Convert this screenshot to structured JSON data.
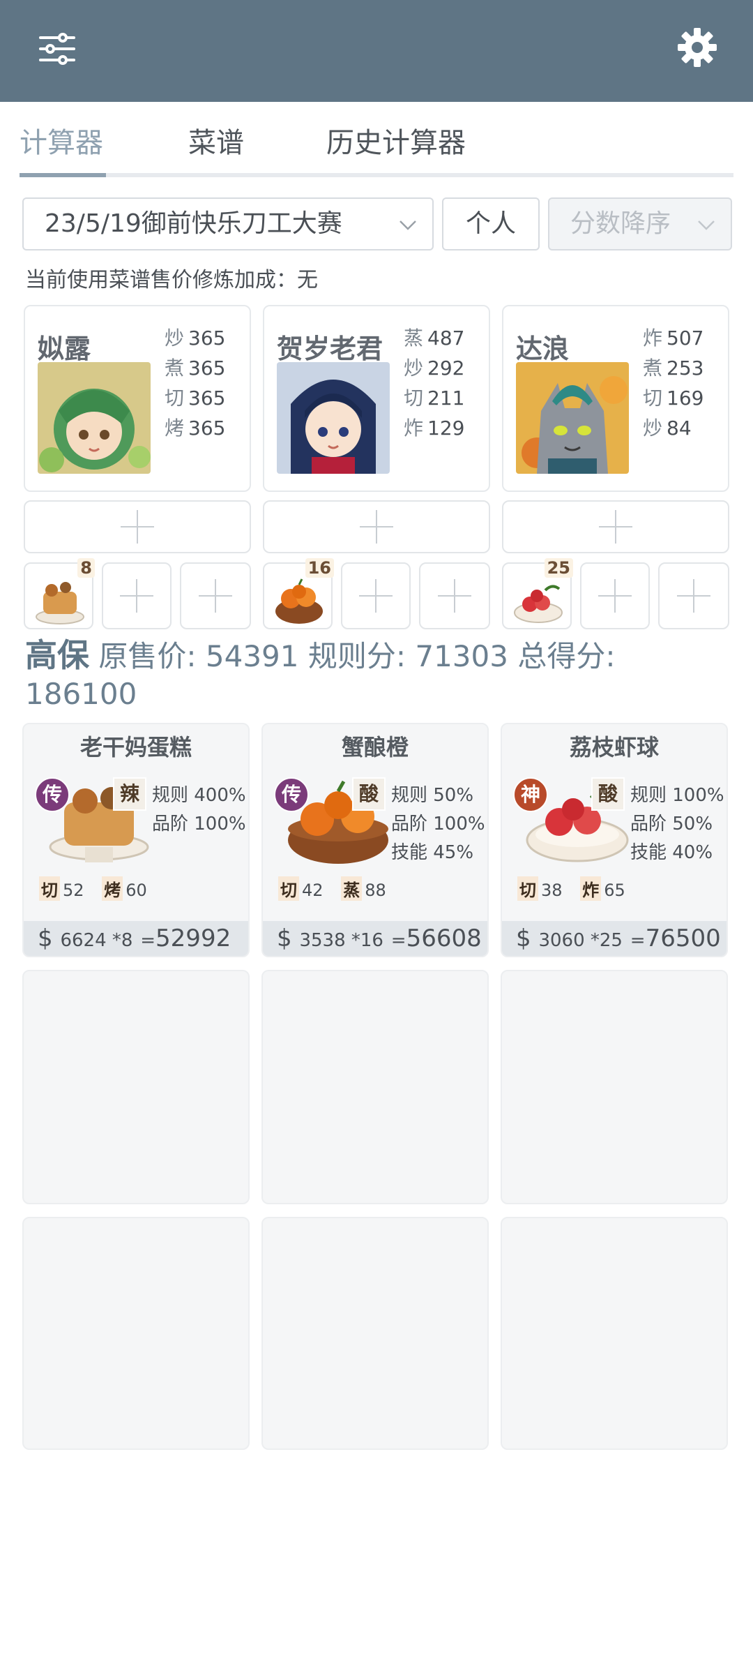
{
  "header": {
    "menu_icon": "sliders-icon",
    "settings_icon": "gear-icon",
    "bg_color": "#5f7585"
  },
  "tabs": [
    {
      "label": "计算器",
      "active": true
    },
    {
      "label": "菜谱",
      "active": false
    },
    {
      "label": "历史计算器",
      "active": false
    }
  ],
  "controls": {
    "contest": "23/5/19御前快乐刀工大赛",
    "mode": "个人",
    "sort": "分数降序"
  },
  "bonus_text": "当前使用菜谱售价修炼加成：无",
  "chefs": [
    {
      "name": "姒露",
      "skills": [
        {
          "k": "炒",
          "v": "365"
        },
        {
          "k": "煮",
          "v": "365"
        },
        {
          "k": "切",
          "v": "365"
        },
        {
          "k": "烤",
          "v": "365"
        }
      ],
      "dish_qty": "8"
    },
    {
      "name": "贺岁老君",
      "skills": [
        {
          "k": "蒸",
          "v": "487"
        },
        {
          "k": "炒",
          "v": "292"
        },
        {
          "k": "切",
          "v": "211"
        },
        {
          "k": "炸",
          "v": "129"
        }
      ],
      "dish_qty": "16"
    },
    {
      "name": "达浪",
      "skills": [
        {
          "k": "炸",
          "v": "507"
        },
        {
          "k": "煮",
          "v": "253"
        },
        {
          "k": "切",
          "v": "169"
        },
        {
          "k": "炒",
          "v": "84"
        }
      ],
      "dish_qty": "25"
    }
  ],
  "summary": {
    "grade": "高保",
    "orig_label": "原售价:",
    "orig_value": "54391",
    "rule_label": "规则分:",
    "rule_value": "71303",
    "total_label": "总得分:",
    "total_value": "186100"
  },
  "dishes": [
    {
      "name": "老干妈蛋糕",
      "rarity": "传",
      "rarity_color": "#7b3b7a",
      "flavor": "辣",
      "stats": [
        "规则 400%",
        "品阶 100%"
      ],
      "req": [
        {
          "k": "切",
          "v": "52"
        },
        {
          "k": "烤",
          "v": "60"
        }
      ],
      "price": "$",
      "unit": "6624 *8",
      "eq": "=",
      "total": "52992"
    },
    {
      "name": "蟹酿橙",
      "rarity": "传",
      "rarity_color": "#7b3b7a",
      "flavor": "酸",
      "stats": [
        "规则 50%",
        "品阶 100%",
        "技能 45%"
      ],
      "req": [
        {
          "k": "切",
          "v": "42"
        },
        {
          "k": "蒸",
          "v": "88"
        }
      ],
      "price": "$",
      "unit": "3538 *16",
      "eq": "=",
      "total": "56608"
    },
    {
      "name": "荔枝虾球",
      "rarity": "神",
      "rarity_color": "#b84a2a",
      "flavor": "酸",
      "stats": [
        "规则 100%",
        "品阶 50%",
        "技能 40%"
      ],
      "req": [
        {
          "k": "切",
          "v": "38"
        },
        {
          "k": "炸",
          "v": "65"
        }
      ],
      "price": "$",
      "unit": "3060 *25",
      "eq": "=",
      "total": "76500"
    }
  ]
}
